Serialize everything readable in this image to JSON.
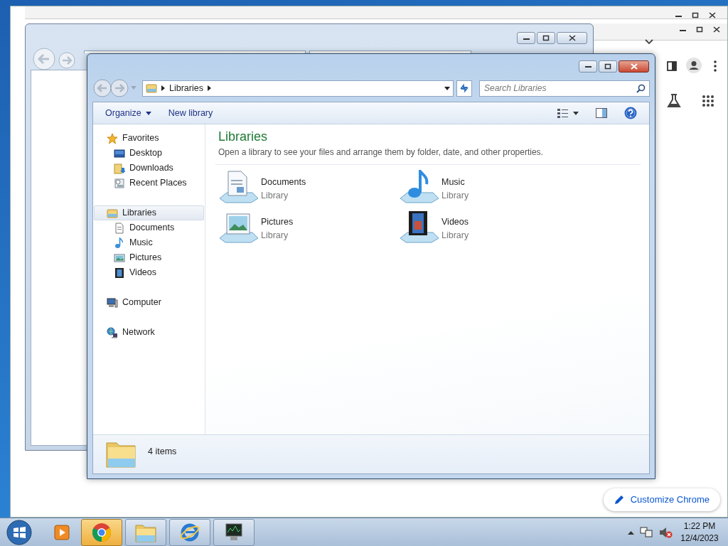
{
  "explorer": {
    "address": [
      "Libraries"
    ],
    "search": {
      "placeholder": "Search Libraries"
    },
    "toolbar": [
      "Organize",
      "New library"
    ],
    "nav": [
      {
        "label": "Favorites",
        "selected": false,
        "children": [
          {
            "label": "Desktop",
            "selected": false
          },
          {
            "label": "Downloads",
            "selected": false
          },
          {
            "label": "Recent Places",
            "selected": false
          }
        ]
      },
      {
        "label": "Libraries",
        "selected": true,
        "children": [
          {
            "label": "Documents",
            "selected": false
          },
          {
            "label": "Music",
            "selected": false
          },
          {
            "label": "Pictures",
            "selected": false
          },
          {
            "label": "Videos",
            "selected": false
          }
        ]
      },
      {
        "label": "Computer",
        "selected": false
      },
      {
        "label": "Network",
        "selected": false
      }
    ],
    "heading": "Libraries",
    "description": "Open a library to see your files and arrange them by folder, date, and other properties.",
    "libraries": [
      {
        "name": "Documents",
        "type": "Library"
      },
      {
        "name": "Music",
        "type": "Library"
      },
      {
        "name": "Pictures",
        "type": "Library"
      },
      {
        "name": "Videos",
        "type": "Library"
      }
    ],
    "status": "4 items"
  },
  "browser": {
    "customize_button": "Customize Chrome"
  },
  "taskbar": {
    "apps": [
      {
        "flashing": false
      },
      {
        "flashing": true
      },
      {
        "flashing": false
      },
      {
        "flashing": false
      },
      {
        "flashing": false
      }
    ],
    "time": "1:22 PM",
    "date": "12/4/2023"
  }
}
